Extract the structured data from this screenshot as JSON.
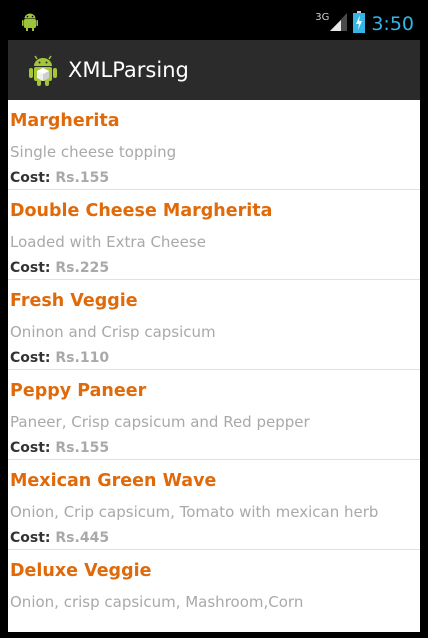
{
  "status_bar": {
    "notification_icon": "android-icon",
    "network": "3G",
    "signal_icon": "signal-icon",
    "battery_icon": "battery-charging-icon",
    "time": "3:50",
    "time_color": "#33b5e5"
  },
  "action_bar": {
    "icon": "android-app-icon",
    "title": "XMLParsing"
  },
  "menu": {
    "cost_label": "Cost:",
    "items": [
      {
        "name": "Margherita",
        "description": "Single cheese topping",
        "cost": "Rs.155"
      },
      {
        "name": "Double Cheese Margherita",
        "description": "Loaded with Extra Cheese",
        "cost": "Rs.225"
      },
      {
        "name": "Fresh Veggie",
        "description": "Oninon and Crisp capsicum",
        "cost": "Rs.110"
      },
      {
        "name": "Peppy Paneer",
        "description": "Paneer, Crisp capsicum and Red pepper",
        "cost": "Rs.155"
      },
      {
        "name": "Mexican Green Wave",
        "description": "Onion, Crip capsicum, Tomato with mexican herb",
        "cost": "Rs.445"
      },
      {
        "name": "Deluxe Veggie",
        "description": "Onion, crisp capsicum, Mashroom,Corn",
        "cost": ""
      }
    ]
  },
  "colors": {
    "name": "#e06a0a",
    "description": "#a9a9a9",
    "action_bar": "#2b2b2b"
  }
}
